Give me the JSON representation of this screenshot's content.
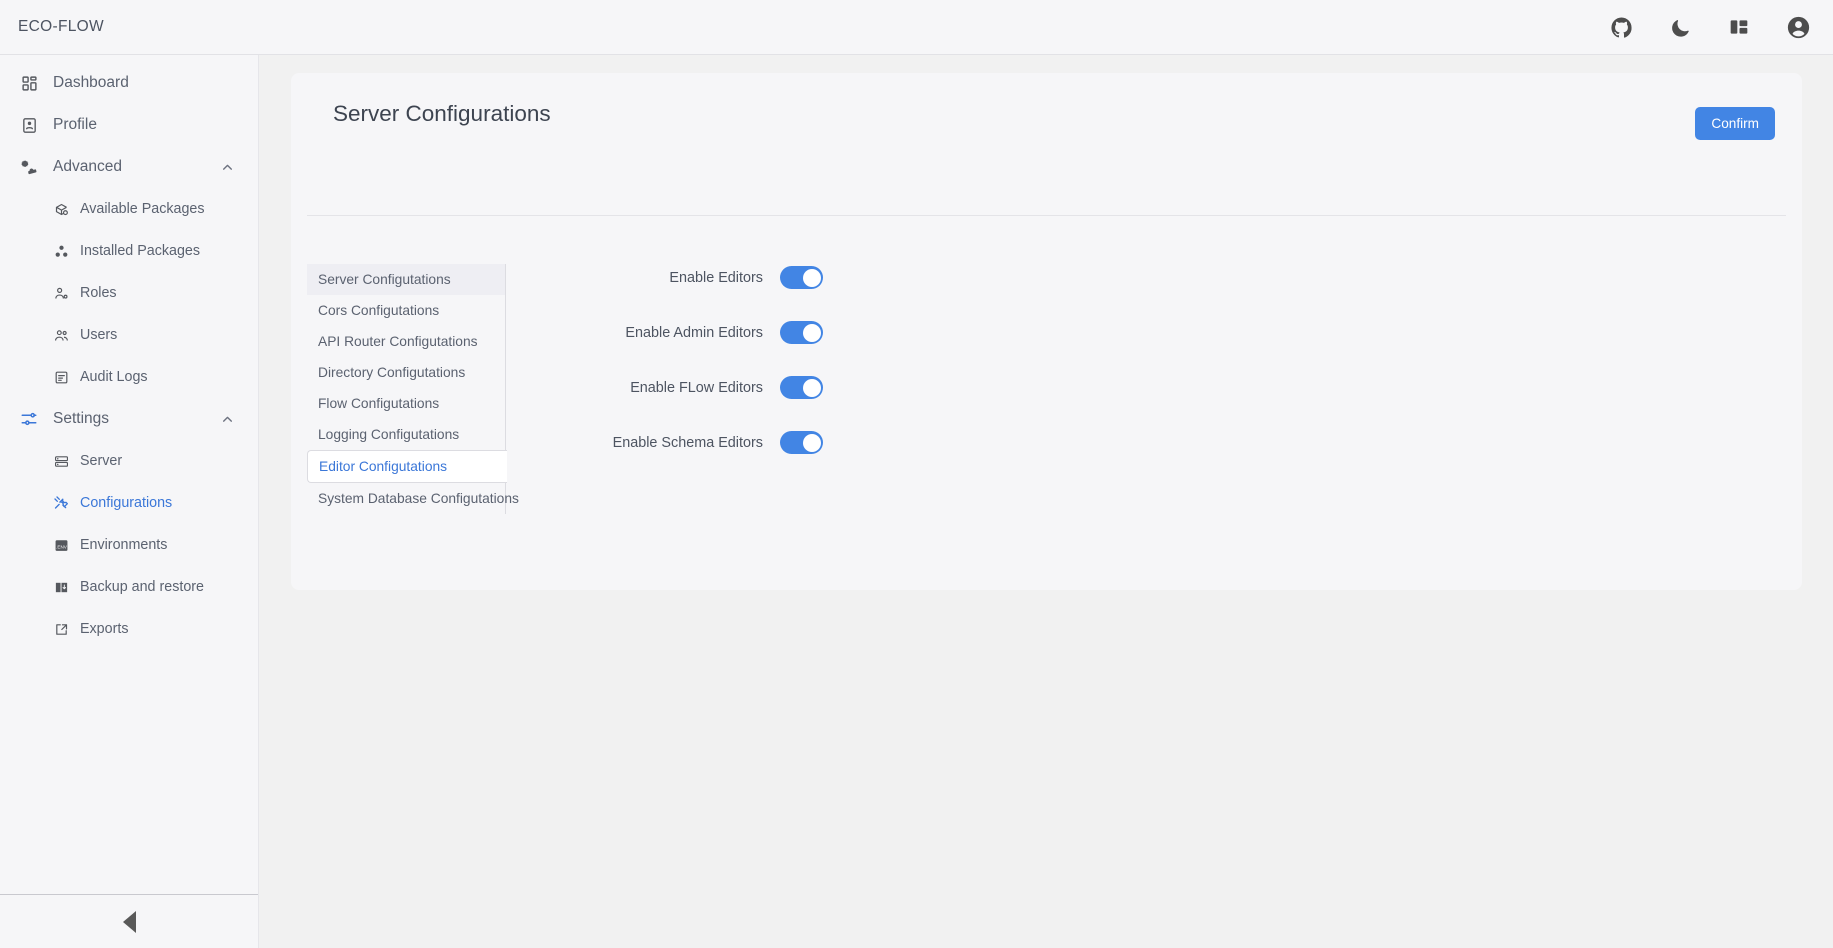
{
  "topbar": {
    "brand": "ECO-FLOW",
    "actions": [
      {
        "name": "github-icon",
        "label": "GitHub"
      },
      {
        "name": "moon-icon",
        "label": "Dark mode"
      },
      {
        "name": "layout-icon",
        "label": "Layout"
      },
      {
        "name": "account-circle-icon",
        "label": "Account"
      }
    ]
  },
  "sidebar": {
    "items": [
      {
        "label": "Dashboard",
        "icon": "dashboard-icon",
        "level": "top",
        "active": false,
        "expandable": false
      },
      {
        "label": "Profile",
        "icon": "profile-icon",
        "level": "top",
        "active": false,
        "expandable": false
      },
      {
        "label": "Advanced",
        "icon": "advanced-gear-icon",
        "level": "top",
        "active": false,
        "expandable": true,
        "expanded": true
      },
      {
        "label": "Available Packages",
        "icon": "package-search-icon",
        "level": "sub",
        "active": false
      },
      {
        "label": "Installed Packages",
        "icon": "packages-icon",
        "level": "sub",
        "active": false
      },
      {
        "label": "Roles",
        "icon": "role-user-icon",
        "level": "sub",
        "active": false
      },
      {
        "label": "Users",
        "icon": "users-icon",
        "level": "sub",
        "active": false
      },
      {
        "label": "Audit Logs",
        "icon": "audit-log-icon",
        "level": "sub",
        "active": false
      },
      {
        "label": "Settings",
        "icon": "sliders-icon",
        "level": "top",
        "active": false,
        "expandable": true,
        "expanded": true
      },
      {
        "label": "Server",
        "icon": "server-icon",
        "level": "sub",
        "active": false
      },
      {
        "label": "Configurations",
        "icon": "tools-icon",
        "level": "sub",
        "active": true
      },
      {
        "label": "Environments",
        "icon": "env-file-icon",
        "level": "sub",
        "active": false
      },
      {
        "label": "Backup and restore",
        "icon": "backup-icon",
        "level": "sub",
        "active": false
      },
      {
        "label": "Exports",
        "icon": "export-icon",
        "level": "sub",
        "active": false
      }
    ],
    "collapse_label": "Collapse sidebar"
  },
  "card": {
    "title": "Server Configurations",
    "confirm_label": "Confirm",
    "tabs": [
      {
        "label": "Server Configutations",
        "state": "selected"
      },
      {
        "label": "Cors Configutations",
        "state": "normal"
      },
      {
        "label": "API Router Configutations",
        "state": "normal"
      },
      {
        "label": "Directory Configutations",
        "state": "normal"
      },
      {
        "label": "Flow Configutations",
        "state": "normal"
      },
      {
        "label": "Logging Configutations",
        "state": "normal"
      },
      {
        "label": "Editor Configutations",
        "state": "active"
      },
      {
        "label": "System Database Configutations",
        "state": "normal"
      }
    ],
    "settings": [
      {
        "label": "Enable Editors",
        "value": true
      },
      {
        "label": "Enable Admin Editors",
        "value": true
      },
      {
        "label": "Enable FLow Editors",
        "value": true
      },
      {
        "label": "Enable Schema Editors",
        "value": true
      }
    ]
  },
  "colors": {
    "accent": "#4285e4",
    "active_text": "#3b77d8",
    "page_bg": "#f1f1f1",
    "panel_bg": "#f6f6f8"
  }
}
